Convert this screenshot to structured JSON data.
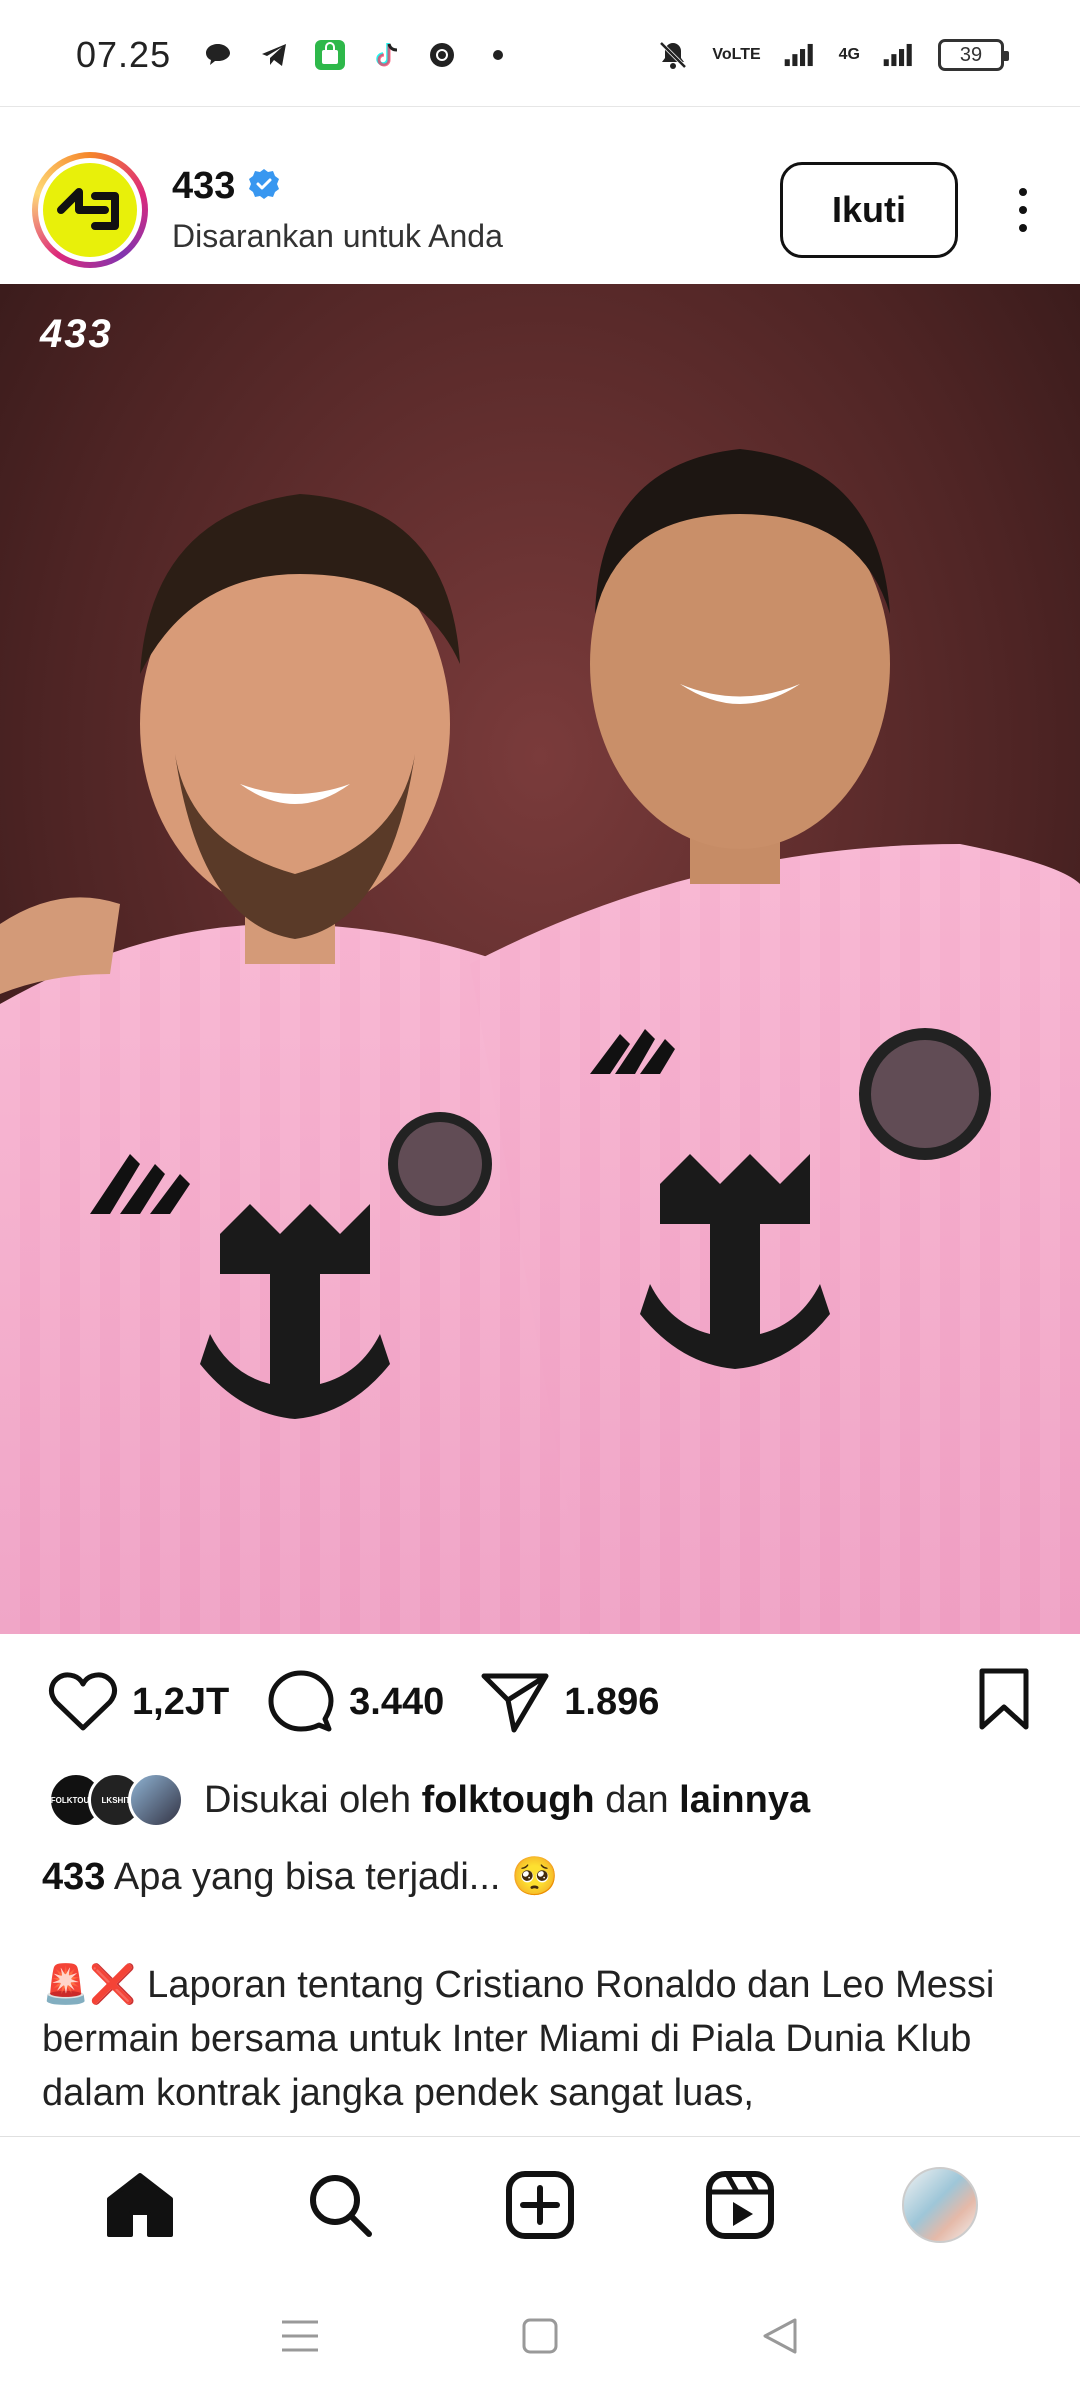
{
  "status_bar": {
    "time": "07.25",
    "network_label_top": "VoLTE",
    "network_label_4g": "4G",
    "battery_level": "39",
    "icons": [
      "chat-bubble-icon",
      "telegram-icon",
      "shopping-bag-icon",
      "tiktok-icon",
      "chrome-icon",
      "dot-icon",
      "mute-bell-icon",
      "signal-icon",
      "signal-4g-icon",
      "battery-icon"
    ]
  },
  "post": {
    "username": "433",
    "verified": true,
    "subtitle": "Disarankan untuk Anda",
    "follow_label": "Ikuti",
    "image_watermark": "433",
    "image_description_colors": {
      "jersey": "#f4a6c8",
      "background": "#5a2b2b"
    }
  },
  "actions": {
    "likes_count": "1,2JT",
    "comments_count": "3.440",
    "shares_count": "1.896"
  },
  "likes": {
    "prefix": "Disukai oleh",
    "user": "folktough",
    "connector": "dan",
    "others": "lainnya",
    "mini_avatars": [
      "FOLKTOUGH",
      "LKSHIT",
      ""
    ]
  },
  "caption": {
    "author": "433",
    "text": "Apa yang bisa terjadi... 🥺",
    "body": "🚨❌ Laporan tentang Cristiano Ronaldo dan Leo Messi bermain bersama untuk Inter Miami di Piala Dunia Klub dalam kontrak jangka pendek sangat luas,"
  },
  "colors": {
    "verified_blue": "#3897f0",
    "avatar_yellow": "#e8f00a"
  }
}
